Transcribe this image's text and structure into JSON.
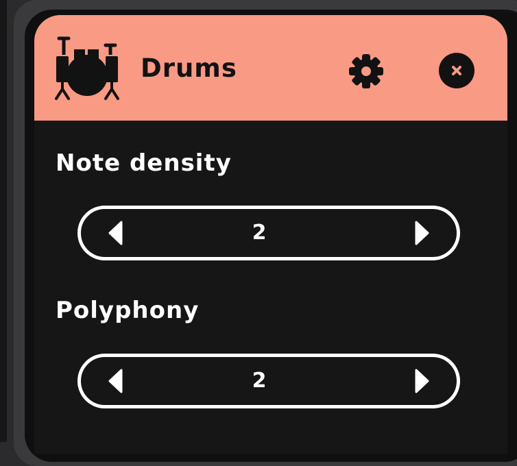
{
  "instrument": {
    "title": "Drums",
    "icon": "drum-kit-icon",
    "header_color": "#f99a84"
  },
  "header_actions": {
    "settings_icon": "gear-icon",
    "close_icon": "close-icon"
  },
  "controls": {
    "note_density": {
      "label": "Note density",
      "value": "2",
      "decrement_icon": "triangle-left-icon",
      "increment_icon": "triangle-right-icon"
    },
    "polyphony": {
      "label": "Polyphony",
      "value": "2",
      "decrement_icon": "triangle-left-icon",
      "increment_icon": "triangle-right-icon"
    }
  },
  "colors": {
    "panel_background": "#161617",
    "text_primary": "#ffffff",
    "header_text": "#121212"
  }
}
